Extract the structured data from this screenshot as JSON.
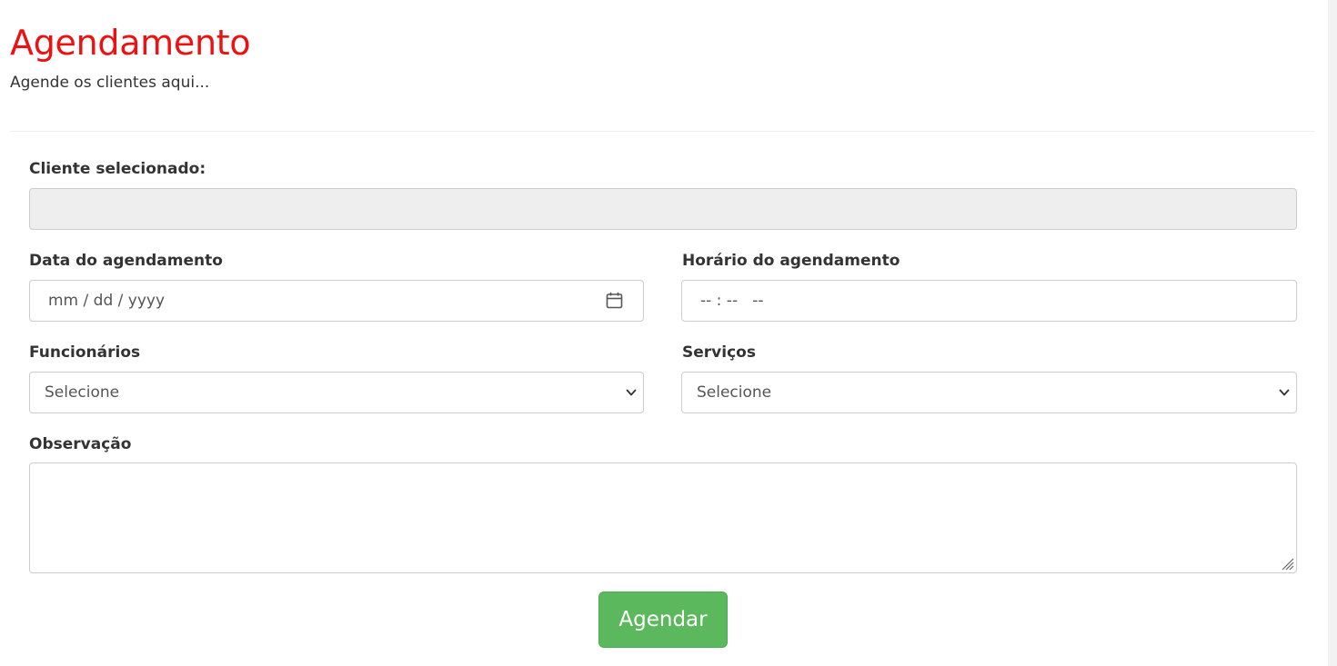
{
  "header": {
    "title": "Agendamento",
    "subtitle": "Agende os clientes aqui..."
  },
  "form": {
    "cliente": {
      "label": "Cliente selecionado:",
      "value": ""
    },
    "data": {
      "label": "Data do agendamento",
      "placeholder": "mm / dd / yyyy",
      "icon": "calendar-icon"
    },
    "horario": {
      "label": "Horário do agendamento",
      "placeholder": "-- : --   --"
    },
    "funcionarios": {
      "label": "Funcionários",
      "selected": "Selecione",
      "icon": "chevron-down-icon"
    },
    "servicos": {
      "label": "Serviços",
      "selected": "Selecione",
      "icon": "chevron-down-icon"
    },
    "observacao": {
      "label": "Observação",
      "value": ""
    },
    "submit_label": "Agendar"
  },
  "colors": {
    "title": "#ee1111",
    "button": "#5cb85c",
    "readonly_bg": "#eeeeee",
    "border": "#cccccc"
  }
}
